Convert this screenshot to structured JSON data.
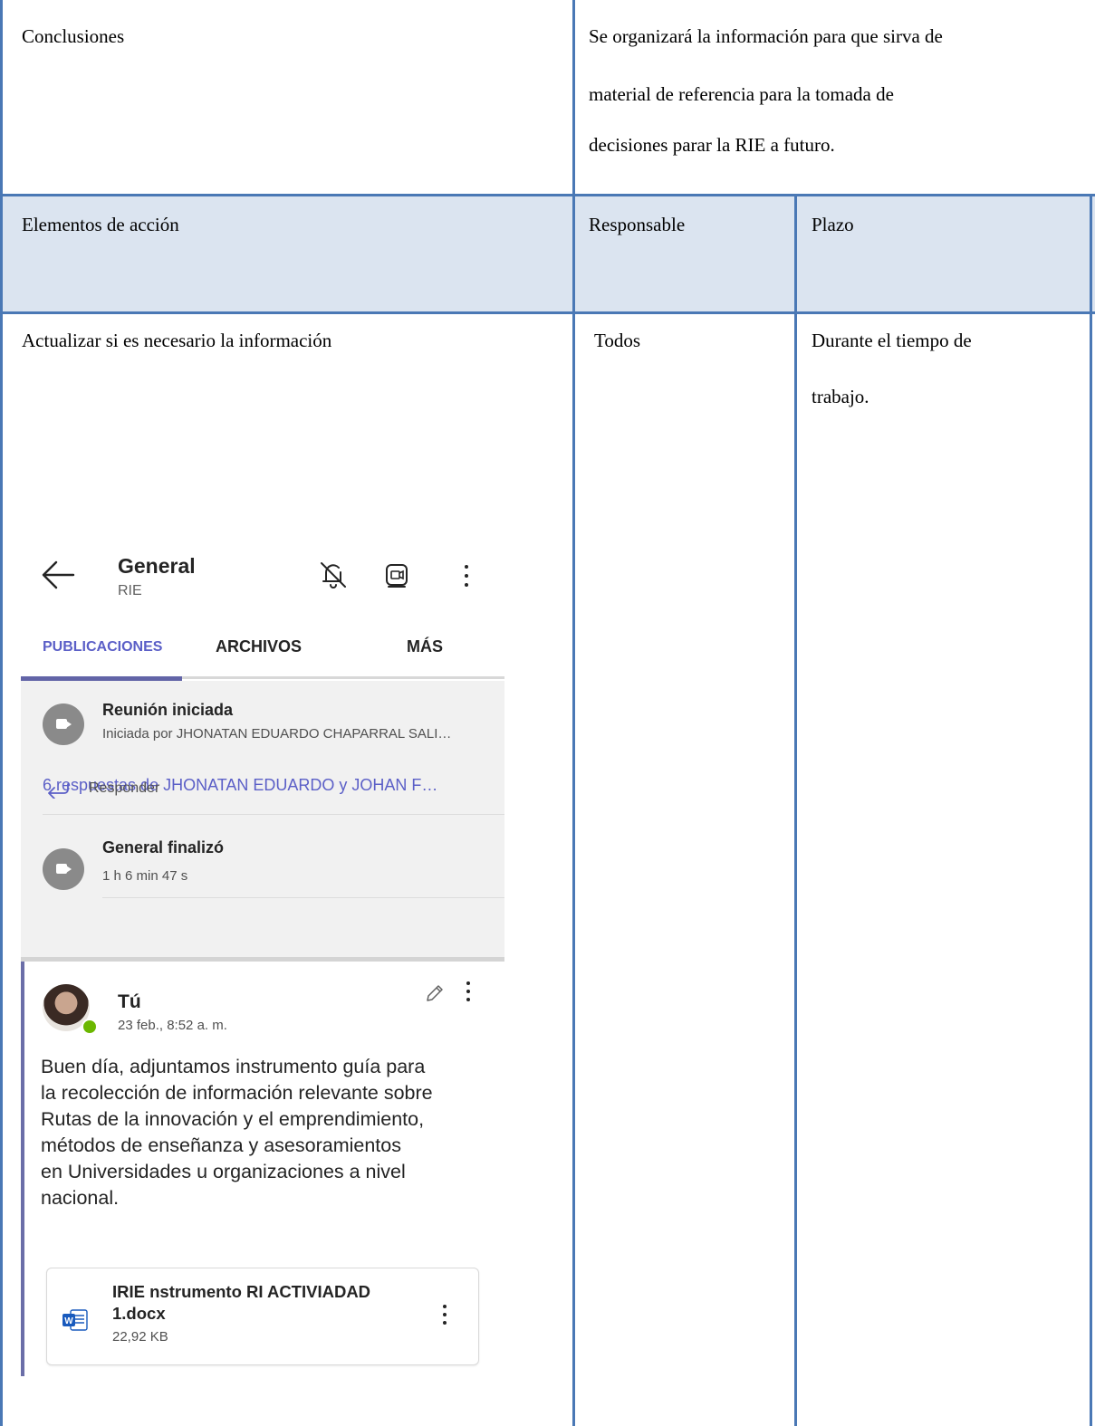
{
  "table": {
    "conclusions": {
      "label": "Conclusiones",
      "text_lines": [
        "Se organizará la información para que sirva de",
        "material de referencia para la tomada de",
        "decisiones parar la RIE a futuro."
      ]
    },
    "header": {
      "action_items": "Elementos de acción",
      "responsible": "Responsable",
      "deadline": "Plazo"
    },
    "row": {
      "action": "Actualizar si es necesario la información",
      "responsible": "Todos",
      "deadline_lines": [
        "Durante el tiempo de",
        "trabajo."
      ]
    }
  },
  "phone": {
    "channel_title": "General",
    "channel_team": "RIE",
    "icons": [
      "back-arrow-icon",
      "bell-off-icon",
      "meet-now-icon",
      "more-vertical-icon"
    ],
    "tabs": [
      {
        "label": "PUBLICACIONES",
        "active": true
      },
      {
        "label": "ARCHIVOS",
        "active": false
      },
      {
        "label": "MÁS",
        "active": false
      }
    ],
    "meeting_started": {
      "title": "Reunión iniciada",
      "subtitle": "Iniciada por JHONATAN EDUARDO CHAPARRAL SALI…"
    },
    "replies_link": "6 respuestas de JHONATAN EDUARDO y JOHAN F…",
    "meeting_ended": {
      "title": "General finalizó",
      "duration": "1 h 6 min 47 s"
    },
    "reply_label": "Responder",
    "post": {
      "author": "Tú",
      "date": "23 feb., 8:52 a. m.",
      "body_lines": [
        "Buen día, adjuntamos instrumento guía para",
        "la recolección de información relevante sobre",
        "Rutas de la innovación y el emprendimiento,",
        "métodos de enseñanza y asesoramientos",
        "en Universidades u organizaciones a nivel",
        "nacional."
      ],
      "attachment": {
        "name_line1": "IRIE nstrumento RI ACTIVIADAD",
        "name_line2": "1.docx",
        "size": "22,92 KB"
      }
    },
    "colors": {
      "accent": "#5b5fc7",
      "post_bar": "#6b6ea8",
      "online": "#6bb700",
      "word_blue": "#185abd"
    }
  },
  "colors": {
    "table_border": "#4a78b5",
    "header_fill": "#dbe4f0"
  }
}
